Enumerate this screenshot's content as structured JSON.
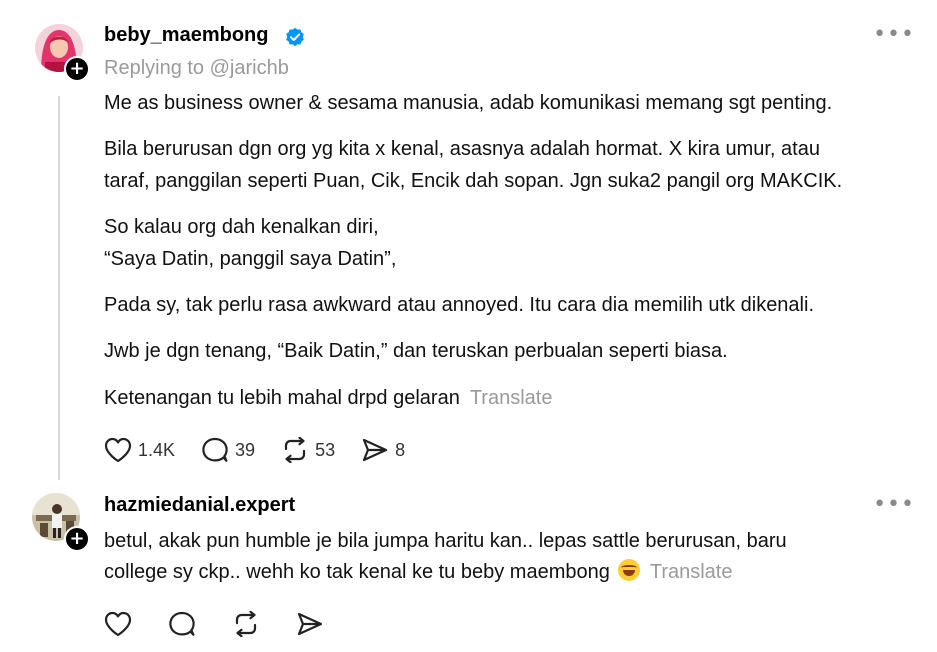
{
  "post1": {
    "username": "beby_maembong",
    "verified": true,
    "replying_to": "Replying to @jarichb",
    "paragraphs": {
      "p1": "Me as business owner & sesama manusia, adab komunikasi memang sgt penting.",
      "p2a": "Bila berurusan dgn org yg kita x kenal, asasnya adalah hormat. X kira umur, atau",
      "p2b": "taraf, panggilan seperti Puan, Cik, Encik dah sopan. Jgn suka2 pangil org MAKCIK.",
      "p3a": "So kalau org dah kenalkan diri,",
      "p3b": "“Saya Datin, panggil saya Datin”,",
      "p4": "Pada sy, tak perlu rasa awkward atau annoyed. Itu cara dia memilih utk dikenali.",
      "p5": "Jwb je dgn tenang, “Baik Datin,” dan teruskan perbualan seperti biasa.",
      "p6": "Ketenangan tu lebih mahal drpd gelaran"
    },
    "translate": "Translate",
    "stats": {
      "likes": "1.4K",
      "comments": "39",
      "reposts": "53",
      "shares": "8"
    }
  },
  "post2": {
    "username": "hazmiedanial.expert",
    "line1": "betul, akak pun humble je bila jumpa haritu kan.. lepas sattle berurusan, baru",
    "line2": "college sy ckp.. wehh ko tak kenal ke tu beby maembong",
    "translate": "Translate"
  },
  "icons": {
    "like": "heart-icon",
    "comment": "speech-bubble-icon",
    "repost": "repost-icon",
    "share": "send-icon",
    "more": "more-horizontal-icon",
    "follow": "plus-icon",
    "verified": "verified-badge-icon"
  },
  "colors": {
    "verified": "#0095f6",
    "muted": "#9a9a9a",
    "text": "#111111"
  }
}
